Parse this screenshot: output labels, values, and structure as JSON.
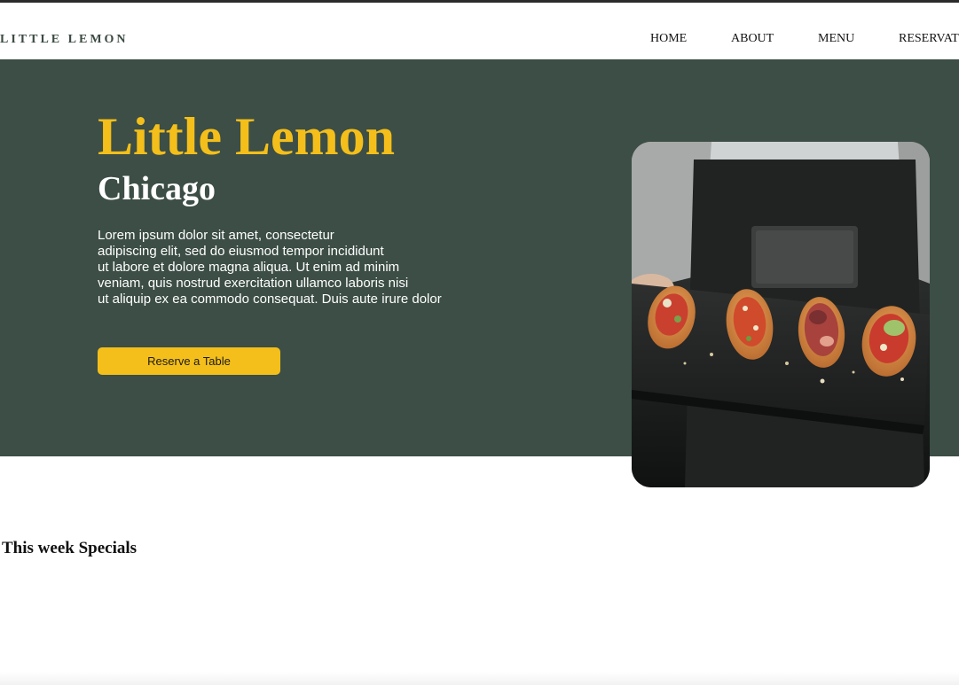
{
  "brand": {
    "logo_text": "LITTLE LEMON"
  },
  "nav": {
    "items": [
      {
        "label": "HOME"
      },
      {
        "label": "ABOUT"
      },
      {
        "label": "MENU"
      },
      {
        "label": "RESERVATIONS"
      }
    ]
  },
  "hero": {
    "title": "Little Lemon",
    "subtitle": "Chicago",
    "description_lines": [
      "Lorem ipsum dolor sit amet, consectetur",
      "adipiscing elit, sed do eiusmod tempor incididunt",
      "ut labore et dolore magna aliqua. Ut enim ad minim",
      "veniam, quis nostrud exercitation ullamco laboris nisi",
      "ut aliquip ex ea commodo consequat. Duis aute irure dolor"
    ],
    "cta_label": "Reserve a Table",
    "image_alt": "chef holding a slate of bruschetta"
  },
  "specials": {
    "title": "This week Specials"
  },
  "colors": {
    "primary_green": "#3c4e46",
    "accent_yellow": "#f4bf1a",
    "text_dark": "#111111",
    "white": "#ffffff"
  }
}
